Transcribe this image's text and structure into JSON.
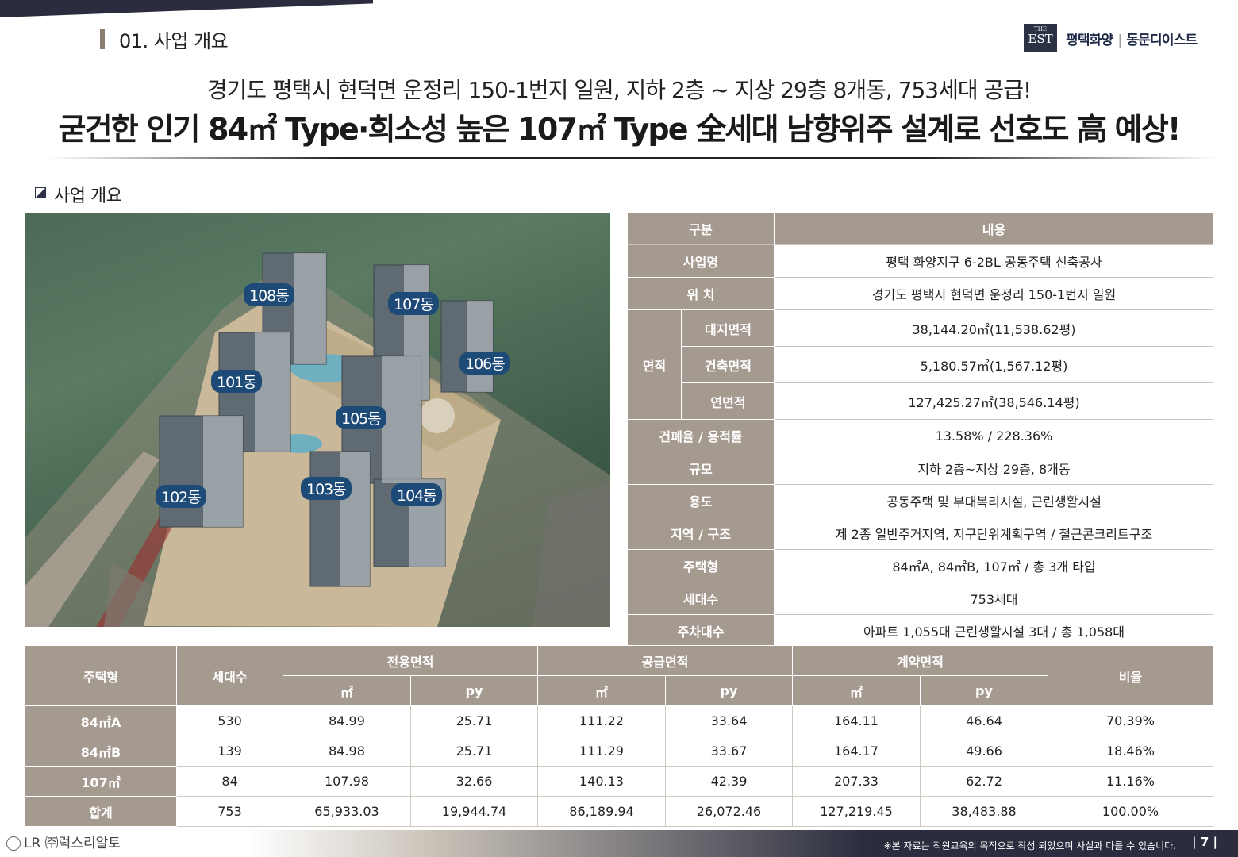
{
  "header": {
    "section_title": "01. 사업 개요",
    "logo_small": "THE",
    "logo_big": "EST",
    "brand_left": "평택화양",
    "brand_right": "동문디이스트"
  },
  "headline": {
    "line1": "경기도 평택시 현덕면 운정리 150-1번지 일원, 지하 2층 ~ 지상 29층 8개동, 753세대 공급!",
    "line2": "굳건한 인기 84㎡ Type·희소성 높은 107㎡ Type 全세대 남향위주 설계로 선호도 高 예상!"
  },
  "subsection": "사업 개요",
  "buildings": [
    "108동",
    "107동",
    "106동",
    "101동",
    "105동",
    "102동",
    "103동",
    "104동"
  ],
  "info_table": {
    "header": [
      "구분",
      "내용"
    ],
    "rows": [
      {
        "label": "사업명",
        "value": "평택 화양지구 6-2BL 공동주택 신축공사"
      },
      {
        "label": "위 치",
        "value": "경기도 평택시 현덕면 운정리 150-1번지 일원"
      },
      {
        "group": "면적",
        "label": "대지면적",
        "value": "38,144.20㎡(11,538.62평)"
      },
      {
        "label": "건축면적",
        "value": "5,180.57㎡(1,567.12평)"
      },
      {
        "label": "연면적",
        "value": "127,425.27㎡(38,546.14평)"
      },
      {
        "label": "건폐율 / 용적률",
        "value": "13.58% / 228.36%"
      },
      {
        "label": "규모",
        "value": "지하 2층~지상 29층, 8개동"
      },
      {
        "label": "용도",
        "value": "공동주택 및 부대복리시설, 근린생활시설"
      },
      {
        "label": "지역 / 구조",
        "value": "제 2종 일반주거지역, 지구단위계획구역 / 철근콘크리트구조"
      },
      {
        "label": "주택형",
        "value": "84㎡A, 84㎡B, 107㎡ / 총 3개 타입"
      },
      {
        "label": "세대수",
        "value": "753세대"
      },
      {
        "label": "주차대수",
        "value": "아파트 1,055대 근린생활시설 3대 / 총 1,058대"
      }
    ]
  },
  "unit_table": {
    "headers": {
      "type": "주택형",
      "households": "세대수",
      "exclusive": "전용면적",
      "supply": "공급면적",
      "contract": "계약면적",
      "ratio": "비율",
      "unit_m2": "㎡",
      "unit_py": "py"
    },
    "rows": [
      [
        "84㎡A",
        "530",
        "84.99",
        "25.71",
        "111.22",
        "33.64",
        "164.11",
        "46.64",
        "70.39%"
      ],
      [
        "84㎡B",
        "139",
        "84.98",
        "25.71",
        "111.29",
        "33.67",
        "164.17",
        "49.66",
        "18.46%"
      ],
      [
        "107㎡",
        "84",
        "107.98",
        "32.66",
        "140.13",
        "42.39",
        "207.33",
        "62.72",
        "11.16%"
      ],
      [
        "합계",
        "753",
        "65,933.03",
        "19,944.74",
        "86,189.94",
        "26,072.46",
        "127,219.45",
        "38,483.88",
        "100.00%"
      ]
    ]
  },
  "footer": {
    "logo": "LR ㈜럭스리알토",
    "note": "※본 자료는 직원교육의 목적으로 작성 되었으며 사실과 다를 수 있습니다.",
    "page": "| 7 |"
  },
  "colors": {
    "header_bg": "#a59a8f",
    "navy": "#2b3246",
    "label_blue": "#1e4a78"
  }
}
